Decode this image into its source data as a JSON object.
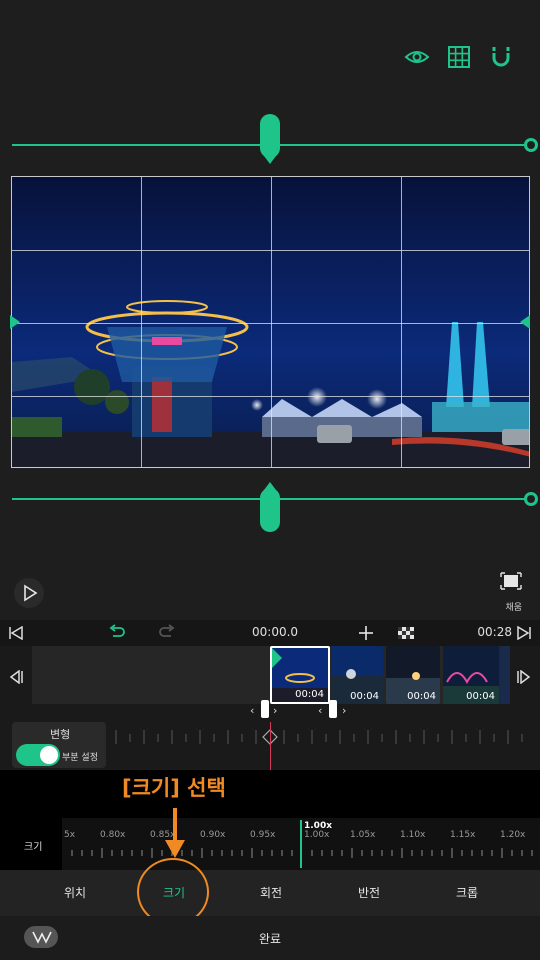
{
  "preview": {
    "icons": [
      "eye-icon",
      "grid-icon",
      "magnet-icon"
    ],
    "fill_label": "채움"
  },
  "timeline": {
    "current_time": "00:00.0",
    "total_time": "00:28",
    "clips": [
      {
        "duration": "00:04"
      },
      {
        "duration": "00:04"
      },
      {
        "duration": "00:04"
      },
      {
        "duration": "00:04"
      }
    ]
  },
  "transform": {
    "label": "변형",
    "partial_setting": "부분 설정",
    "toggle_on": true
  },
  "annotation": {
    "text": "[크기] 선택"
  },
  "scale": {
    "label": "크기",
    "current": "1.00x",
    "ticks": [
      "5x",
      "0.80x",
      "0.85x",
      "0.90x",
      "0.95x",
      "1.00x",
      "1.05x",
      "1.10x",
      "1.15x",
      "1.20x"
    ]
  },
  "tabs": [
    "위치",
    "크기",
    "회전",
    "반전",
    "크롭"
  ],
  "active_tab_index": 1,
  "bottom": {
    "done_label": "완료"
  },
  "colors": {
    "accent": "#1fc48a",
    "annotation": "#f08a24",
    "playhead": "#d13a5a"
  }
}
